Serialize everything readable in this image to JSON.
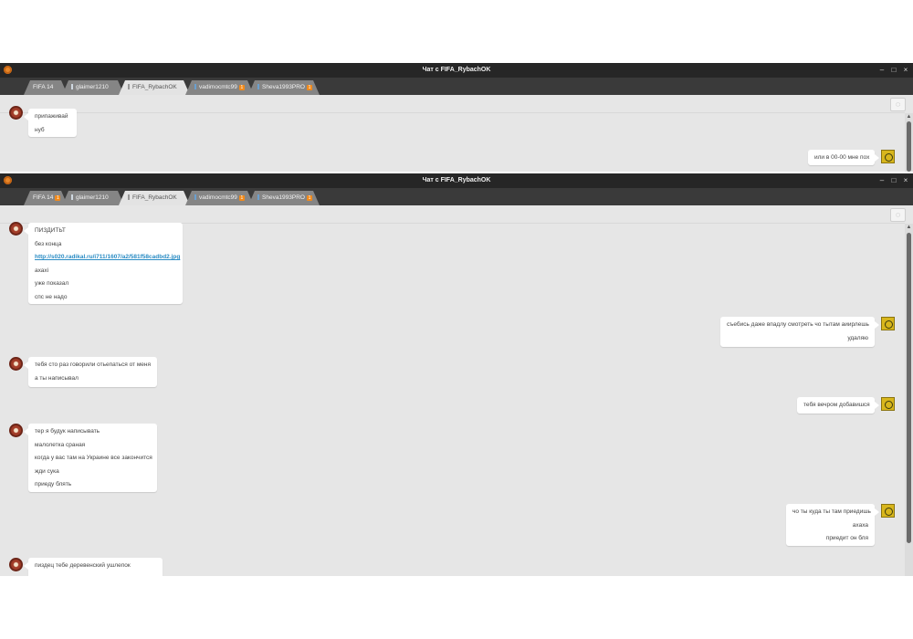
{
  "window_top": {
    "title": "Чат с FIFA_RybachOK",
    "controls": {
      "minimize": "–",
      "maximize": "□",
      "close": "×"
    },
    "tabs": [
      {
        "label": "FIFA 14",
        "badge": ""
      },
      {
        "label": "glaimer1210",
        "badge": ""
      },
      {
        "label": "FIFA_RybachOK",
        "badge": ""
      },
      {
        "label": "vadimocmtc99",
        "badge": "1"
      },
      {
        "label": "Sheva1993PRO",
        "badge": "1"
      }
    ],
    "messages": [
      {
        "side": "left",
        "lines": [
          "припаживай",
          "нуб"
        ]
      },
      {
        "side": "right",
        "lines": [
          "или в 00-00 мне пох"
        ]
      }
    ]
  },
  "window_bottom": {
    "title": "Чат с FIFA_RybachOK",
    "controls": {
      "minimize": "–",
      "maximize": "□",
      "close": "×"
    },
    "tabs": [
      {
        "label": "FIFA 14",
        "badge": "1"
      },
      {
        "label": "glaimer1210",
        "badge": ""
      },
      {
        "label": "FIFA_RybachOK",
        "badge": ""
      },
      {
        "label": "vadimocmtc99",
        "badge": "1"
      },
      {
        "label": "Sheva1993PRO",
        "badge": "1"
      }
    ],
    "messages": [
      {
        "side": "left",
        "lines": [
          "ПИЗДИТЬТ",
          "без конца",
          "http://s020.radikal.ru/i711/1607/a2/581f58cadbd2.jpg",
          "ахахі",
          "уже показал",
          "спс не надо"
        ]
      },
      {
        "side": "right",
        "lines": [
          "съебись даже впадлу смотреть чо тытам аиирлешь",
          "удаляю"
        ]
      },
      {
        "side": "left",
        "lines": [
          "тебя сто раз говорили отьепаться от меня",
          "а ты написывал"
        ]
      },
      {
        "side": "right",
        "lines": [
          "тебя вечром добавишся"
        ]
      },
      {
        "side": "left",
        "lines": [
          "тер я будук написывать",
          "малолетка сраная",
          "когда у вас там на Украине все закончится",
          "жди сука",
          "приеду блять"
        ]
      },
      {
        "side": "right",
        "lines": [
          "чо ты куда ты там приедишь",
          "ахаха",
          "приедит он бля"
        ]
      },
      {
        "side": "left",
        "lines": [
          "пиздец тебе деревенский ушлепок"
        ]
      }
    ]
  }
}
